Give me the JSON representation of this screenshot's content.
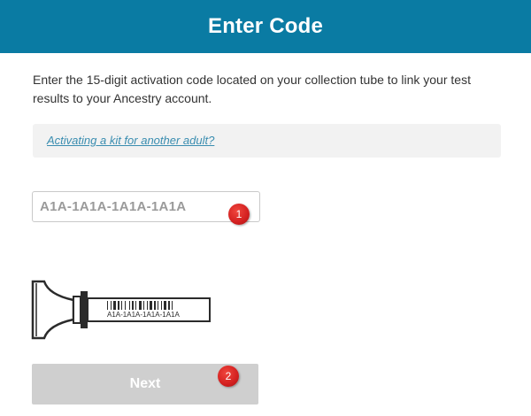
{
  "header": {
    "title": "Enter Code",
    "background_color": "#0a7ba3"
  },
  "instructions": {
    "text": "Enter the 15-digit activation code located on your collection tube to link your test results to your Ancestry account."
  },
  "info_box": {
    "link_text": "Activating a kit for another adult?"
  },
  "code_field": {
    "placeholder": "A1A-1A1A-1A1A-1A1A",
    "value": ""
  },
  "markers": {
    "one": "1",
    "two": "2"
  },
  "tube_illustration": {
    "barcode_text": "A1A-1A1A-1A1A-1A1A"
  },
  "next_button": {
    "label": "Next",
    "background_color": "#cfcfcf"
  }
}
